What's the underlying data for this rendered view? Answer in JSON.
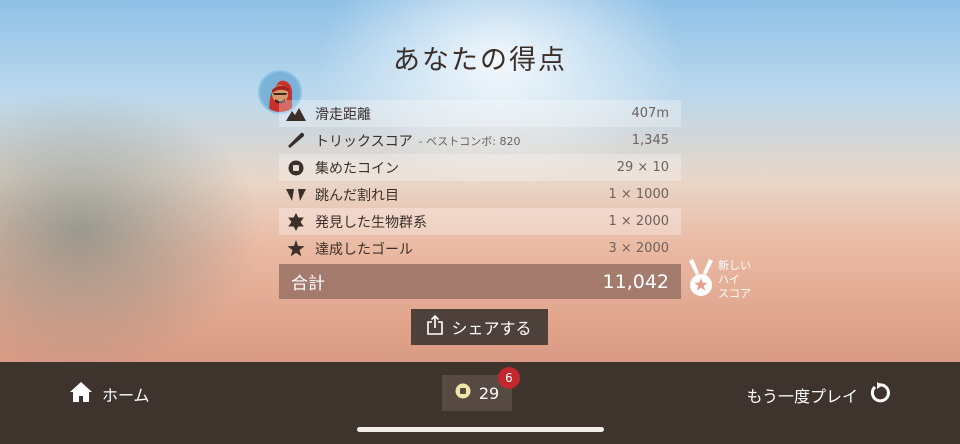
{
  "screen": {
    "title": "あなたの得点"
  },
  "score_rows": [
    {
      "icon": "mountain-icon",
      "label": "滑走距離",
      "note": "",
      "value": "407m"
    },
    {
      "icon": "trick-icon",
      "label": "トリックスコア",
      "note": "- ベストコンボ: 820",
      "value": "1,345"
    },
    {
      "icon": "coin-icon",
      "label": "集めたコイン",
      "note": "",
      "value": "29 × 10"
    },
    {
      "icon": "chasm-icon",
      "label": "跳んだ割れ目",
      "note": "",
      "value": "1 × 1000"
    },
    {
      "icon": "biome-icon",
      "label": "発見した生物群系",
      "note": "",
      "value": "1 × 2000"
    },
    {
      "icon": "star-icon",
      "label": "達成したゴール",
      "note": "",
      "value": "3 × 2000"
    }
  ],
  "total": {
    "label": "合計",
    "value": "11,042"
  },
  "high_score_badge": {
    "line1": "新しい",
    "line2": "ハイ",
    "line3": "スコア"
  },
  "share_button": {
    "label": "シェアする"
  },
  "bottom_bar": {
    "home_label": "ホーム",
    "coin_count": "29",
    "notification_count": "6",
    "replay_label": "もう一度プレイ"
  },
  "colors": {
    "bar_background": "#3e332d",
    "total_background": "#7a5a52",
    "notification_badge": "#c1272d"
  }
}
